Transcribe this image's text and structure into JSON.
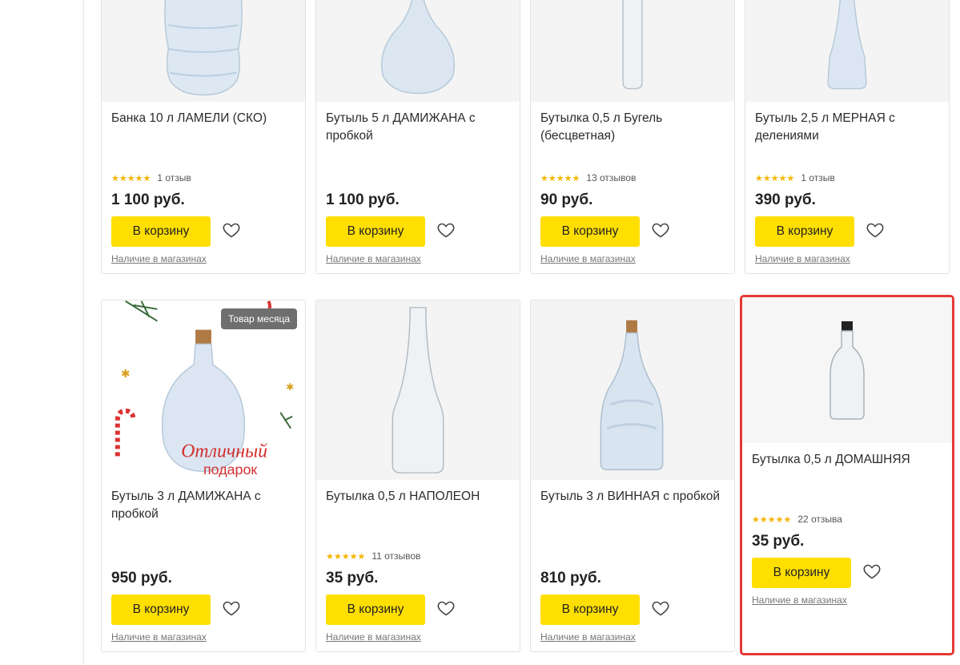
{
  "colors": {
    "accent": "#ffdf00",
    "star": "#f5b400",
    "highlight": "#e53935"
  },
  "products": [
    {
      "title": "Банка 10 л ЛАМЕЛИ (СКО)",
      "stars": 5,
      "reviews": "1 отзыв",
      "price": "1 100 руб.",
      "cart": "В корзину",
      "availability": "Наличие в магазинах"
    },
    {
      "title": "Бутыль 5 л ДАМИЖАНА с пробкой",
      "stars": 0,
      "reviews": "",
      "price": "1 100 руб.",
      "cart": "В корзину",
      "availability": "Наличие в магазинах"
    },
    {
      "title": "Бутылка 0,5 л Бугель (бесцветная)",
      "stars": 5,
      "reviews": "13 отзывов",
      "price": "90 руб.",
      "cart": "В корзину",
      "availability": "Наличие в магазинах"
    },
    {
      "title": "Бутыль 2,5 л МЕРНАЯ с делениями",
      "stars": 5,
      "reviews": "1 отзыв",
      "price": "390 руб.",
      "cart": "В корзину",
      "availability": "Наличие в магазинах"
    },
    {
      "title": "Бутыль 3 л ДАМИЖАНА с пробкой",
      "badge": "Товар месяца",
      "promo_text": [
        "Отличный",
        "подарок"
      ],
      "stars": 0,
      "reviews": "",
      "price": "950 руб.",
      "cart": "В корзину",
      "availability": "Наличие в магазинах"
    },
    {
      "title": "Бутылка 0,5 л НАПОЛЕОН",
      "stars": 5,
      "reviews": "11 отзывов",
      "price": "35 руб.",
      "cart": "В корзину",
      "availability": "Наличие в магазинах"
    },
    {
      "title": "Бутыль 3 л ВИННАЯ с пробкой",
      "stars": 0,
      "reviews": "",
      "price": "810 руб.",
      "cart": "В корзину",
      "availability": "Наличие в магазинах"
    },
    {
      "title": "Бутылка 0,5 л ДОМАШНЯЯ",
      "stars": 5,
      "reviews": "22 отзыва",
      "price": "35 руб.",
      "cart": "В корзину",
      "availability": "Наличие в магазинах"
    }
  ],
  "icons": {
    "favorite": "heart-outline-icon",
    "rating": "star-icon"
  }
}
